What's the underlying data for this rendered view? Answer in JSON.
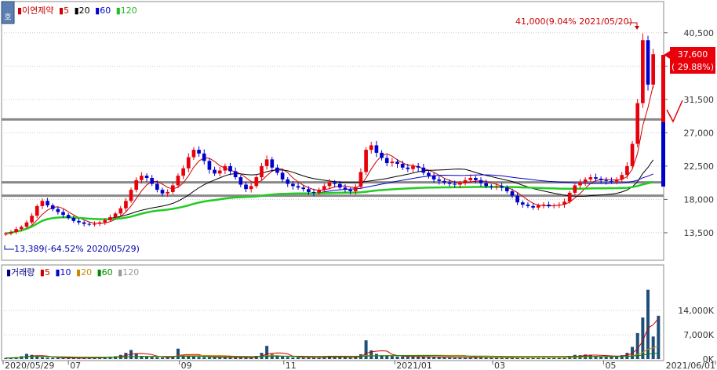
{
  "header": {
    "corner_label": "호",
    "price_legend": [
      {
        "text": "▮이연제약",
        "color": "#cc0000"
      },
      {
        "text": "▮5",
        "color": "#cc0000"
      },
      {
        "text": "▮20",
        "color": "#000000"
      },
      {
        "text": "▮60",
        "color": "#0000cc"
      },
      {
        "text": "▮120",
        "color": "#22bb22"
      }
    ],
    "volume_legend": [
      {
        "text": "▮거래량",
        "color": "#000080"
      },
      {
        "text": "▮5",
        "color": "#cc0000"
      },
      {
        "text": "▮10",
        "color": "#0000cc"
      },
      {
        "text": "▮20",
        "color": "#cc8800"
      },
      {
        "text": "▮60",
        "color": "#008800"
      },
      {
        "text": "▮120",
        "color": "#999999"
      }
    ]
  },
  "annotations": {
    "high": "41,000(9.04% 2021/05/20)",
    "low": "13,389(-64.52% 2020/05/29)",
    "current_price": "37,600",
    "current_change": "( 29.88%)"
  },
  "chart_data": {
    "type": "candlestick",
    "title": "이연제약",
    "x_labels": [
      "2020/05/29",
      "07",
      "09",
      "11",
      "2021/01",
      "03",
      "05",
      "2021/06/01"
    ],
    "price_axis": {
      "ticks": [
        "40,500",
        "36,000",
        "31,500",
        "27,000",
        "22,500",
        "18,000",
        "13,500"
      ],
      "ylim": [
        10000,
        44500
      ]
    },
    "volume_axis": {
      "ticks": [
        "14,000K",
        "7,000K",
        "0K"
      ],
      "ylim": [
        0,
        24000
      ]
    },
    "moving_averages": [
      "5",
      "20",
      "60",
      "120"
    ],
    "horizontal_levels": [
      28800,
      20300,
      18500
    ],
    "high": {
      "value": 41000,
      "change_pct": 9.04,
      "date": "2021/05/20"
    },
    "low": {
      "value": 13389,
      "change_pct": -64.52,
      "date": "2020/05/29"
    },
    "last_close": {
      "value": 37600,
      "change_pct": 29.88
    },
    "close_series": [
      13400,
      13600,
      14000,
      14300,
      14900,
      15800,
      17100,
      17800,
      17200,
      16700,
      16300,
      15900,
      15500,
      15100,
      14900,
      14700,
      14600,
      14700,
      14900,
      15200,
      15600,
      16100,
      16800,
      17800,
      19300,
      20600,
      21200,
      20900,
      20100,
      19300,
      18800,
      19000,
      19900,
      21200,
      22200,
      23700,
      24700,
      24200,
      23200,
      22000,
      21500,
      21900,
      22500,
      21800,
      21000,
      20000,
      19400,
      19800,
      21000,
      22500,
      23400,
      22300,
      21600,
      20700,
      20100,
      19800,
      19600,
      19400,
      19000,
      18900,
      19300,
      19800,
      20300,
      20100,
      19600,
      19300,
      19100,
      19700,
      21700,
      24700,
      25300,
      24300,
      23600,
      22900,
      23100,
      22800,
      22300,
      22100,
      22500,
      22300,
      21600,
      21200,
      20700,
      20500,
      20300,
      20100,
      20000,
      20200,
      20600,
      20900,
      20600,
      20200,
      19800,
      19700,
      19800,
      19600,
      19100,
      18500,
      17600,
      17300,
      17100,
      16900,
      17200,
      17300,
      17100,
      17200,
      17300,
      17700,
      18900,
      19900,
      20300,
      20700,
      21000,
      20800,
      20600,
      20500,
      20400,
      20700,
      21300,
      22500,
      25500,
      31000,
      39500,
      33500,
      37600
    ],
    "volume_series": [
      300,
      400,
      500,
      800,
      1500,
      1200,
      700,
      500,
      400,
      350,
      300,
      300,
      300,
      300,
      300,
      300,
      350,
      400,
      400,
      500,
      700,
      800,
      1200,
      1800,
      2600,
      1500,
      900,
      700,
      600,
      500,
      400,
      450,
      800,
      3000,
      1200,
      900,
      700,
      600,
      550,
      500,
      450,
      450,
      500,
      500,
      450,
      400,
      400,
      450,
      900,
      1800,
      3800,
      1400,
      900,
      700,
      600,
      500,
      450,
      400,
      400,
      400,
      450,
      600,
      700,
      600,
      500,
      450,
      400,
      500,
      1400,
      5400,
      2500,
      1500,
      1100,
      900,
      800,
      700,
      700,
      650,
      800,
      700,
      600,
      550,
      500,
      450,
      450,
      400,
      400,
      450,
      500,
      550,
      500,
      450,
      400,
      400,
      450,
      400,
      400,
      400,
      400,
      400,
      400,
      400,
      500,
      450,
      400,
      400,
      450,
      550,
      900,
      1200,
      1100,
      1300,
      1200,
      900,
      800,
      800,
      800,
      900,
      1100,
      1800,
      3500,
      7500,
      12000,
      20000,
      6500,
      12500
    ]
  }
}
